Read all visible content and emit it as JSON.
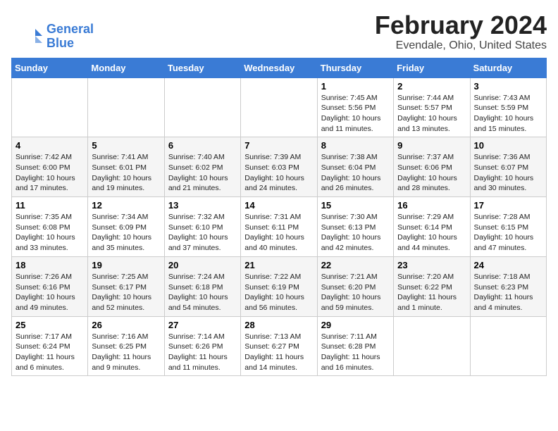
{
  "app": {
    "logo_line1": "General",
    "logo_line2": "Blue"
  },
  "header": {
    "month": "February 2024",
    "location": "Evendale, Ohio, United States"
  },
  "weekdays": [
    "Sunday",
    "Monday",
    "Tuesday",
    "Wednesday",
    "Thursday",
    "Friday",
    "Saturday"
  ],
  "weeks": [
    [
      {
        "day": "",
        "detail": ""
      },
      {
        "day": "",
        "detail": ""
      },
      {
        "day": "",
        "detail": ""
      },
      {
        "day": "",
        "detail": ""
      },
      {
        "day": "1",
        "detail": "Sunrise: 7:45 AM\nSunset: 5:56 PM\nDaylight: 10 hours\nand 11 minutes."
      },
      {
        "day": "2",
        "detail": "Sunrise: 7:44 AM\nSunset: 5:57 PM\nDaylight: 10 hours\nand 13 minutes."
      },
      {
        "day": "3",
        "detail": "Sunrise: 7:43 AM\nSunset: 5:59 PM\nDaylight: 10 hours\nand 15 minutes."
      }
    ],
    [
      {
        "day": "4",
        "detail": "Sunrise: 7:42 AM\nSunset: 6:00 PM\nDaylight: 10 hours\nand 17 minutes."
      },
      {
        "day": "5",
        "detail": "Sunrise: 7:41 AM\nSunset: 6:01 PM\nDaylight: 10 hours\nand 19 minutes."
      },
      {
        "day": "6",
        "detail": "Sunrise: 7:40 AM\nSunset: 6:02 PM\nDaylight: 10 hours\nand 21 minutes."
      },
      {
        "day": "7",
        "detail": "Sunrise: 7:39 AM\nSunset: 6:03 PM\nDaylight: 10 hours\nand 24 minutes."
      },
      {
        "day": "8",
        "detail": "Sunrise: 7:38 AM\nSunset: 6:04 PM\nDaylight: 10 hours\nand 26 minutes."
      },
      {
        "day": "9",
        "detail": "Sunrise: 7:37 AM\nSunset: 6:06 PM\nDaylight: 10 hours\nand 28 minutes."
      },
      {
        "day": "10",
        "detail": "Sunrise: 7:36 AM\nSunset: 6:07 PM\nDaylight: 10 hours\nand 30 minutes."
      }
    ],
    [
      {
        "day": "11",
        "detail": "Sunrise: 7:35 AM\nSunset: 6:08 PM\nDaylight: 10 hours\nand 33 minutes."
      },
      {
        "day": "12",
        "detail": "Sunrise: 7:34 AM\nSunset: 6:09 PM\nDaylight: 10 hours\nand 35 minutes."
      },
      {
        "day": "13",
        "detail": "Sunrise: 7:32 AM\nSunset: 6:10 PM\nDaylight: 10 hours\nand 37 minutes."
      },
      {
        "day": "14",
        "detail": "Sunrise: 7:31 AM\nSunset: 6:11 PM\nDaylight: 10 hours\nand 40 minutes."
      },
      {
        "day": "15",
        "detail": "Sunrise: 7:30 AM\nSunset: 6:13 PM\nDaylight: 10 hours\nand 42 minutes."
      },
      {
        "day": "16",
        "detail": "Sunrise: 7:29 AM\nSunset: 6:14 PM\nDaylight: 10 hours\nand 44 minutes."
      },
      {
        "day": "17",
        "detail": "Sunrise: 7:28 AM\nSunset: 6:15 PM\nDaylight: 10 hours\nand 47 minutes."
      }
    ],
    [
      {
        "day": "18",
        "detail": "Sunrise: 7:26 AM\nSunset: 6:16 PM\nDaylight: 10 hours\nand 49 minutes."
      },
      {
        "day": "19",
        "detail": "Sunrise: 7:25 AM\nSunset: 6:17 PM\nDaylight: 10 hours\nand 52 minutes."
      },
      {
        "day": "20",
        "detail": "Sunrise: 7:24 AM\nSunset: 6:18 PM\nDaylight: 10 hours\nand 54 minutes."
      },
      {
        "day": "21",
        "detail": "Sunrise: 7:22 AM\nSunset: 6:19 PM\nDaylight: 10 hours\nand 56 minutes."
      },
      {
        "day": "22",
        "detail": "Sunrise: 7:21 AM\nSunset: 6:20 PM\nDaylight: 10 hours\nand 59 minutes."
      },
      {
        "day": "23",
        "detail": "Sunrise: 7:20 AM\nSunset: 6:22 PM\nDaylight: 11 hours\nand 1 minute."
      },
      {
        "day": "24",
        "detail": "Sunrise: 7:18 AM\nSunset: 6:23 PM\nDaylight: 11 hours\nand 4 minutes."
      }
    ],
    [
      {
        "day": "25",
        "detail": "Sunrise: 7:17 AM\nSunset: 6:24 PM\nDaylight: 11 hours\nand 6 minutes."
      },
      {
        "day": "26",
        "detail": "Sunrise: 7:16 AM\nSunset: 6:25 PM\nDaylight: 11 hours\nand 9 minutes."
      },
      {
        "day": "27",
        "detail": "Sunrise: 7:14 AM\nSunset: 6:26 PM\nDaylight: 11 hours\nand 11 minutes."
      },
      {
        "day": "28",
        "detail": "Sunrise: 7:13 AM\nSunset: 6:27 PM\nDaylight: 11 hours\nand 14 minutes."
      },
      {
        "day": "29",
        "detail": "Sunrise: 7:11 AM\nSunset: 6:28 PM\nDaylight: 11 hours\nand 16 minutes."
      },
      {
        "day": "",
        "detail": ""
      },
      {
        "day": "",
        "detail": ""
      }
    ]
  ]
}
